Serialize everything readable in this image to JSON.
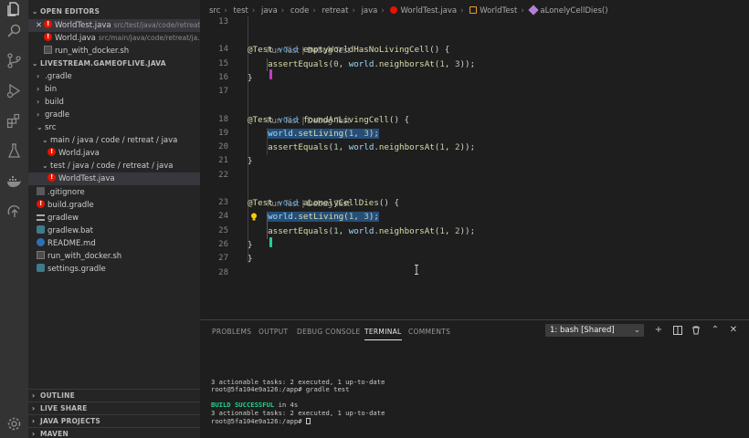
{
  "activity_bar": {
    "icons": [
      "files-icon",
      "search-icon",
      "source-control-icon",
      "run-debug-icon",
      "extensions-icon",
      "testing-icon",
      "docker-icon",
      "remote-icon",
      "settings-gear-icon"
    ]
  },
  "sidebar": {
    "open_editors_title": "OPEN EDITORS",
    "open_editors": [
      {
        "name": "WorldTest.java",
        "path": "src/test/java/code/retreat...",
        "icon": "error-icon",
        "active": true
      },
      {
        "name": "World.java",
        "path": "src/main/java/code/retreat/ja...",
        "icon": "error-icon",
        "active": false
      },
      {
        "name": "run_with_docker.sh",
        "path": "",
        "icon": "shell-file-icon",
        "active": false
      }
    ],
    "project_title": "LIVESTREAM.GAMEOFLIVE.JAVA",
    "tree": [
      {
        "label": ".gradle",
        "indent": 1,
        "twisty": "›"
      },
      {
        "label": "bin",
        "indent": 1,
        "twisty": "›"
      },
      {
        "label": "build",
        "indent": 1,
        "twisty": "›"
      },
      {
        "label": "gradle",
        "indent": 1,
        "twisty": "›"
      },
      {
        "label": "src",
        "indent": 1,
        "twisty": "⌄"
      },
      {
        "label": "main / java / code / retreat / java",
        "indent": 2,
        "twisty": "⌄"
      },
      {
        "label": "World.java",
        "indent": 3,
        "twisty": "",
        "icon": "error-icon"
      },
      {
        "label": "test / java / code / retreat / java",
        "indent": 2,
        "twisty": "⌄"
      },
      {
        "label": "WorldTest.java",
        "indent": 3,
        "twisty": "",
        "icon": "error-icon",
        "selected": true
      },
      {
        "label": ".gitignore",
        "indent": 1,
        "twisty": "",
        "icon": "git-icon"
      },
      {
        "label": "build.gradle",
        "indent": 1,
        "twisty": "",
        "icon": "error-icon"
      },
      {
        "label": "gradlew",
        "indent": 1,
        "twisty": "",
        "icon": "lines-icon"
      },
      {
        "label": "gradlew.bat",
        "indent": 1,
        "twisty": "",
        "icon": "gradle-icon"
      },
      {
        "label": "README.md",
        "indent": 1,
        "twisty": "",
        "icon": "info-icon"
      },
      {
        "label": "run_with_docker.sh",
        "indent": 1,
        "twisty": "",
        "icon": "shell-file-icon"
      },
      {
        "label": "settings.gradle",
        "indent": 1,
        "twisty": "",
        "icon": "gradle-icon"
      }
    ],
    "bottom_sections": [
      "OUTLINE",
      "LIVE SHARE",
      "JAVA PROJECTS",
      "MAVEN"
    ]
  },
  "breadcrumb": [
    "src",
    "test",
    "java",
    "code",
    "retreat",
    "java",
    "WorldTest.java",
    "WorldTest",
    "aLonelyCellDies()"
  ],
  "editor": {
    "code_lens": "Run Test | Debug Test",
    "lines": [
      {
        "n": "13",
        "tokens": []
      },
      {
        "n": "14",
        "lens": true,
        "tokens": [
          [
            "anno",
            "@Test "
          ],
          [
            "kw",
            "void "
          ],
          [
            "fn",
            "emptyWorldHasNoLivingCell"
          ],
          [
            "pun",
            "() {"
          ]
        ]
      },
      {
        "n": "15",
        "tokens": [
          [
            "pun",
            "    "
          ],
          [
            "fn",
            "assertEquals"
          ],
          [
            "pun",
            "("
          ],
          [
            "num",
            "0"
          ],
          [
            "pun",
            ", "
          ],
          [
            "var",
            "world"
          ],
          [
            "pun",
            "."
          ],
          [
            "fn",
            "neighborsAt"
          ],
          [
            "pun",
            "("
          ],
          [
            "num",
            "1"
          ],
          [
            "pun",
            ", "
          ],
          [
            "num",
            "3"
          ],
          [
            "pun",
            "));"
          ]
        ]
      },
      {
        "n": "16",
        "tokens": [
          [
            "pun",
            "}"
          ]
        ]
      },
      {
        "n": "17",
        "tokens": []
      },
      {
        "n": "18",
        "lens": true,
        "tokens": [
          [
            "anno",
            "@Test "
          ],
          [
            "kw",
            "void "
          ],
          [
            "fn",
            "foundAnLivingCell"
          ],
          [
            "pun",
            "() {"
          ]
        ]
      },
      {
        "n": "19",
        "tokens": [
          [
            "pun",
            "    "
          ],
          [
            "hlvar",
            "world"
          ],
          [
            "hlpun",
            "."
          ],
          [
            "hlfn",
            "setLiving"
          ],
          [
            "hlpun",
            "("
          ],
          [
            "hlnum",
            "1"
          ],
          [
            "hlpun",
            ", "
          ],
          [
            "hlnum",
            "3"
          ],
          [
            "hlpun",
            ");"
          ]
        ]
      },
      {
        "n": "20",
        "tokens": [
          [
            "pun",
            "    "
          ],
          [
            "fn",
            "assertEquals"
          ],
          [
            "pun",
            "("
          ],
          [
            "num",
            "1"
          ],
          [
            "pun",
            ", "
          ],
          [
            "var",
            "world"
          ],
          [
            "pun",
            "."
          ],
          [
            "fn",
            "neighborsAt"
          ],
          [
            "pun",
            "("
          ],
          [
            "num",
            "1"
          ],
          [
            "pun",
            ", "
          ],
          [
            "num",
            "2"
          ],
          [
            "pun",
            "));"
          ]
        ]
      },
      {
        "n": "21",
        "tokens": [
          [
            "pun",
            "}"
          ]
        ]
      },
      {
        "n": "22",
        "tokens": []
      },
      {
        "n": "23",
        "lens": true,
        "tokens": [
          [
            "anno",
            "@Test "
          ],
          [
            "kw",
            "void "
          ],
          [
            "fn",
            "aLonelyCellDies"
          ],
          [
            "pun",
            "() {"
          ]
        ]
      },
      {
        "n": "24",
        "tokens": [
          [
            "pun",
            "    "
          ],
          [
            "hlvar",
            "world"
          ],
          [
            "hlpun",
            "."
          ],
          [
            "hlfn",
            "setLiving"
          ],
          [
            "hlpun",
            "("
          ],
          [
            "hlnum",
            "1"
          ],
          [
            "hlpun",
            ", "
          ],
          [
            "hlnum",
            "3"
          ],
          [
            "hlpun",
            ");"
          ]
        ]
      },
      {
        "n": "25",
        "tokens": [
          [
            "pun",
            "    "
          ],
          [
            "fn",
            "assertEquals"
          ],
          [
            "pun",
            "("
          ],
          [
            "num",
            "1"
          ],
          [
            "pun",
            ", "
          ],
          [
            "var",
            "world"
          ],
          [
            "pun",
            "."
          ],
          [
            "fn",
            "neighborsAt"
          ],
          [
            "pun",
            "("
          ],
          [
            "num",
            "1"
          ],
          [
            "pun",
            ", "
          ],
          [
            "num",
            "2"
          ],
          [
            "pun",
            "));"
          ]
        ]
      },
      {
        "n": "26",
        "tokens": [
          [
            "pun",
            "}"
          ]
        ]
      },
      {
        "n": "27",
        "tokens": [
          [
            "pun",
            "}"
          ]
        ]
      },
      {
        "n": "28",
        "tokens": []
      }
    ]
  },
  "panel": {
    "tabs": [
      "PROBLEMS",
      "OUTPUT",
      "DEBUG CONSOLE",
      "TERMINAL",
      "COMMENTS"
    ],
    "active_tab": "TERMINAL",
    "terminal_select": "1: bash [Shared]",
    "actions": [
      "plus-icon",
      "split-icon",
      "trash-icon",
      "maximize-icon",
      "close-icon"
    ],
    "terminal_lines": [
      {
        "text": "3 actionable tasks: 2 executed, 1 up-to-date",
        "style": ""
      },
      {
        "text": "root@5fa104e9a126:/app# gradle test",
        "style": ""
      },
      {
        "text": "",
        "style": ""
      },
      {
        "text": "BUILD SUCCESSFUL",
        "suffix": " in 4s",
        "style": "ok"
      },
      {
        "text": "3 actionable tasks: 2 executed, 1 up-to-date",
        "style": ""
      },
      {
        "text": "root@5fa104e9a126:/app# ",
        "style": "prompt"
      }
    ]
  },
  "colors": {
    "accent_error": "#e51400",
    "selection": "#264f78",
    "success": "#23d18b"
  }
}
